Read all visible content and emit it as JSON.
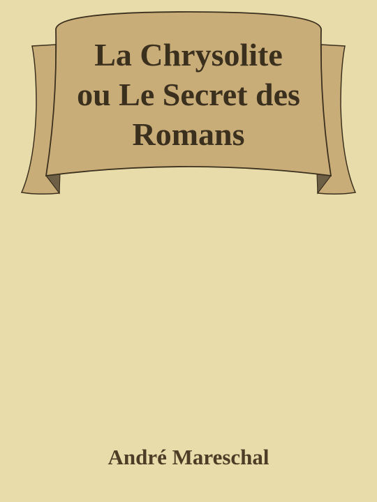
{
  "cover": {
    "title_lines": [
      "La Chrysolite",
      "ou Le Secret des",
      "Romans"
    ],
    "author": "André Mareschal"
  },
  "colors": {
    "background": "#e8dcaa",
    "banner_fill": "#c8ad78",
    "banner_fold": "#6e5f47",
    "outline": "#3b2f1e",
    "title_text": "#3b2f1e",
    "author_text": "#4b3d26"
  }
}
